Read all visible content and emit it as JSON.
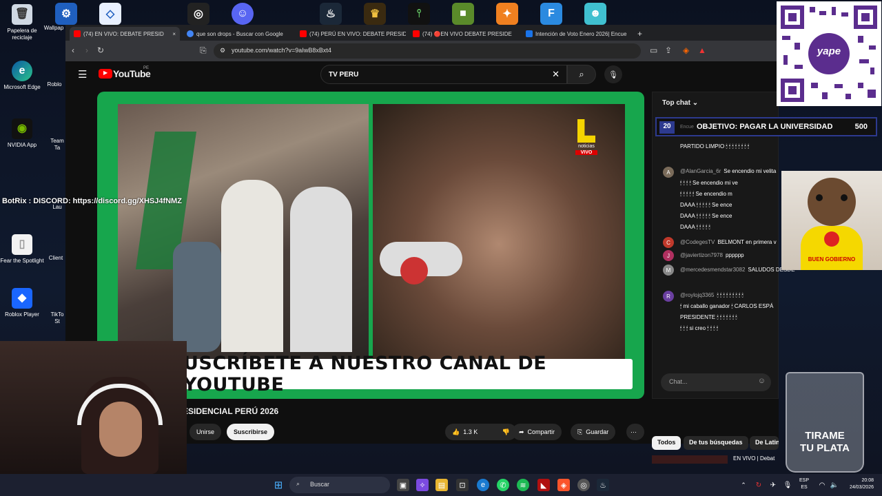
{
  "desktop": {
    "icons_left": [
      {
        "label": "Papelera de reciclaje",
        "icon": "recycle-bin-icon"
      },
      {
        "label": "Microsoft Edge",
        "icon": "edge-icon"
      },
      {
        "label": "NVIDIA App",
        "icon": "nvidia-icon"
      },
      {
        "label": "Fear the Spotlight",
        "icon": "file-icon"
      },
      {
        "label": "Roblox Player",
        "icon": "roblox-icon"
      }
    ],
    "icons_col2": [
      "Wallpap",
      "Roblo",
      "Team Ta",
      "Lau",
      "Client",
      "TikTo St"
    ]
  },
  "browser": {
    "tabs": [
      {
        "label": "(74) EN VIVO: DEBATE PRESID",
        "color": "#ff0000"
      },
      {
        "label": "que son drops - Buscar con Google",
        "color": "#4285f4"
      },
      {
        "label": "(74) PERÚ EN VIVO: DEBATE PRESIDE",
        "color": "#ff0000"
      },
      {
        "label": "(74) 🔴EN VIVO DEBATE PRESIDE",
        "color": "#ff0000"
      },
      {
        "label": "Intención de Voto Enero 2026| Encue",
        "color": "#1a73e8"
      }
    ],
    "close_tab": "×",
    "new_tab": "+",
    "url": "youtube.com/watch?v=9aIwB8xBxt4"
  },
  "youtube": {
    "logo": "YouTube",
    "region": "PE",
    "search_value": "TV PERU",
    "video_banner": "USCRÍBETE A NUESTRO CANAL DE YOUTUBE",
    "channel_logo_text": "noticias",
    "live_badge": "VIVO",
    "video_title": "ESIDENCIAL PERÚ 2026",
    "join_label": "Unirse",
    "subscribe_label": "Suscribirse",
    "likes": "1.3 K",
    "share_label": "Compartir",
    "save_label": "Guardar",
    "more_label": "⋯"
  },
  "chat": {
    "header": "Top chat",
    "goal_label": "OBJETIVO: PAGAR LA UNIVERSIDAD",
    "goal_value": "500",
    "goal_prefix": "20",
    "goal_under": "Encue",
    "messages": [
      {
        "author": "",
        "text": "PARTIDO LIMPIO 🕯 🕯 🕯 🕯 🕯 🕯 🕯 🕯"
      },
      {
        "author": "@AlanGarcia_6r",
        "text": "Se encendio mi velita"
      },
      {
        "author": "",
        "text": "🕯 🕯 🕯 🕯 Se encendio mi ve"
      },
      {
        "author": "",
        "text": "🕯 🕯 🕯 🕯 🕯 Se encendio m"
      },
      {
        "author": "",
        "text": "DAAA 🕯 🕯 🕯 🕯 🕯 Se ence"
      },
      {
        "author": "",
        "text": "DAAA 🕯 🕯 🕯 🕯 🕯 Se ence"
      },
      {
        "author": "",
        "text": "DAAA 🕯 🕯 🕯 🕯 🕯"
      },
      {
        "author": "@CodegesTV",
        "text": "BELMONT en primera v"
      },
      {
        "author": "@javiertizon7978",
        "text": "pppppp"
      },
      {
        "author": "@mercedesmendstar3082",
        "text": "SALUDOS DESDE"
      },
      {
        "author": "@roylojq3365",
        "text": "🕯 🕯 🕯 🕯 🕯 🕯 🕯 🕯 🕯"
      },
      {
        "author": "",
        "text": "🕯 mi caballo ganador 🕯 CARLOS ESPÁ"
      },
      {
        "author": "",
        "text": "PRESIDENTE 🕯 🕯 🕯 🕯 🕯 🕯 🕯"
      },
      {
        "author": "",
        "text": "🕯 🕯 🕯 si creo 🕯 🕯 🕯 🕯"
      }
    ],
    "input_placeholder": "Chat...",
    "chips": [
      "Todos",
      "De tus búsquedas",
      "De Latina Noticia"
    ],
    "related": "EN VIVO | Debat"
  },
  "overlays": {
    "discord_text": "BotRix : DISCORD: https://discord.gg/XHSJ4fNMZ",
    "qr_label": "yape",
    "dog_caption": "BUEN GOBIERNO",
    "jar_text_1": "TIRAME",
    "jar_text_2": "TU PLATA"
  },
  "taskbar": {
    "search_placeholder": "Buscar",
    "lang_top": "ESP",
    "lang_bottom": "ES",
    "time": "20:08",
    "date": "24/03/2026"
  },
  "colors": {
    "yt_red": "#ff0000",
    "video_green": "#17a64d",
    "goal_border": "#2d3a8f",
    "qr_purple": "#5b2d8e"
  }
}
